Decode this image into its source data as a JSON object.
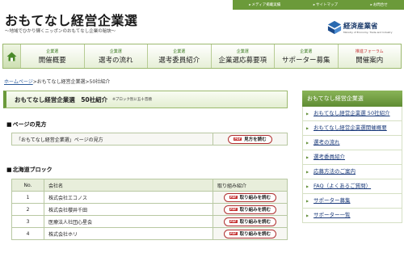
{
  "util_links": [
    "メディア掲載実績",
    "サイトマップ",
    "お問合せ"
  ],
  "site": {
    "title": "おもてなし経営企業選",
    "subtitle": "〜地域でひかり輝くニッポンのおもてなし企業の秘訣〜"
  },
  "ministry": {
    "name": "経済産業省",
    "en": "Ministry of Economy, Trade and Industry"
  },
  "nav": [
    {
      "top": "企業選",
      "main": "開催概要",
      "color": "#3a7a20"
    },
    {
      "top": "企業選",
      "main": "選考の流れ",
      "color": "#3a7a20"
    },
    {
      "top": "企業選",
      "main": "選考委員紹介",
      "color": "#3a7a20"
    },
    {
      "top": "企業選",
      "main": "企業選応募要項",
      "color": "#3a7a20"
    },
    {
      "top": "企業選",
      "main": "サポーター募集",
      "color": "#3a7a20"
    },
    {
      "top": "推進フォーラム",
      "main": "開催案内",
      "color": "#c43a3a"
    }
  ],
  "breadcrumb": {
    "home": "ホームページ",
    "sep": ">",
    "mid": "おもてなし経営企業選",
    "current": "50社紹介"
  },
  "page_title": {
    "main": "おもてなし経営企業選　50社紹介",
    "note": "※ブロック別に五十音順"
  },
  "howto": {
    "heading": "ページの見方",
    "text": "「おもてなし経営企業選」ページの見方",
    "button": "見方を読む"
  },
  "hokkaido": {
    "heading": "北海道ブロック",
    "columns": [
      "No.",
      "会社名",
      "取り組み紹介"
    ],
    "rows": [
      {
        "no": "1",
        "name": "株式会社エコノス",
        "button": "取り組みを読む"
      },
      {
        "no": "2",
        "name": "株式会社櫻井千田",
        "button": "取り組みを読む"
      },
      {
        "no": "3",
        "name": "医療法人社団心星会",
        "button": "取り組みを読む"
      },
      {
        "no": "4",
        "name": "株式会社ホリ",
        "button": "取り組みを読む"
      }
    ]
  },
  "pdf_label": "PDF",
  "sidebar": {
    "heading": "おもてなし経営企業選",
    "items": [
      "おもてなし経営企業選 50社紹介",
      "おもてなし経営企業選開催概要",
      "選考の流れ",
      "選考委員紹介",
      "応募方法のご案内",
      "FAQ（よくあるご質問）",
      "サポーター募集",
      "サポーター一覧"
    ]
  }
}
